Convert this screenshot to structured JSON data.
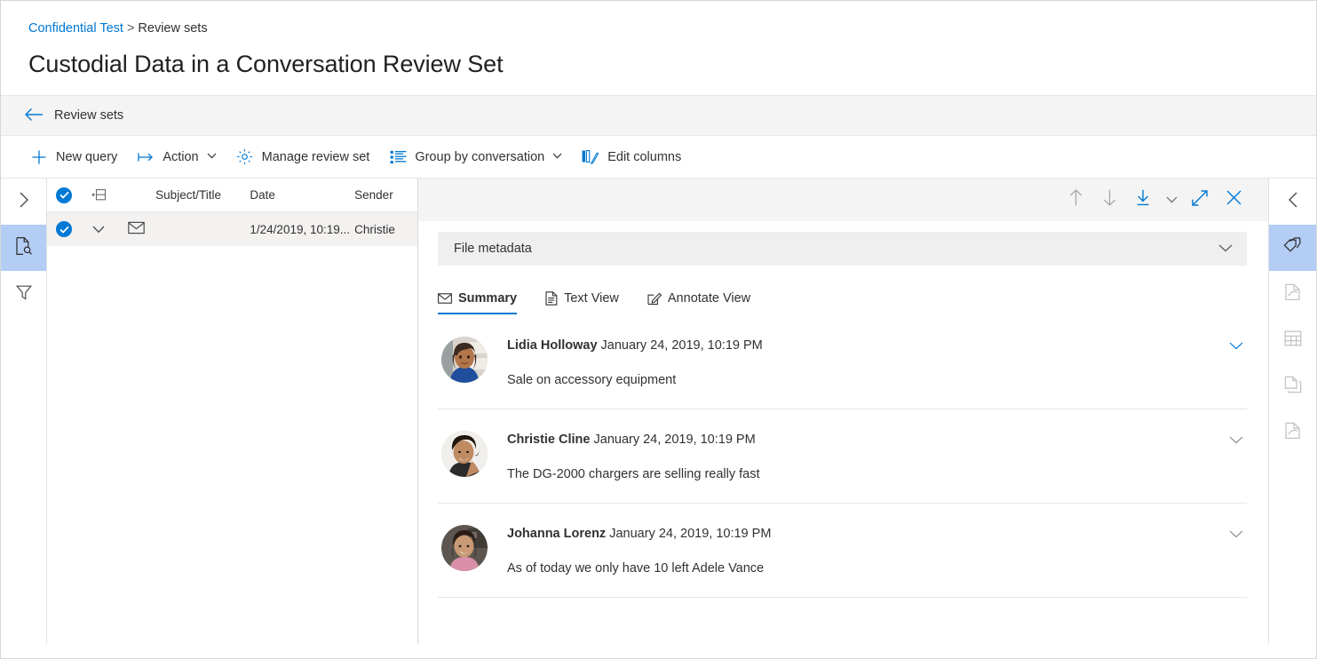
{
  "breadcrumb": {
    "link": "Confidential Test",
    "separator": ">",
    "current": "Review sets"
  },
  "page_title": "Custodial Data in a Conversation Review Set",
  "back_bar": {
    "label": "Review sets",
    "icon": "arrow-left-icon"
  },
  "command_bar": {
    "items": [
      {
        "label": "New query",
        "icon": "plus-icon",
        "chevron": false
      },
      {
        "label": "Action",
        "icon": "action-arrow-icon",
        "chevron": true
      },
      {
        "label": "Manage review set",
        "icon": "gear-icon",
        "chevron": false
      },
      {
        "label": "Group by conversation",
        "icon": "group-list-icon",
        "chevron": true
      },
      {
        "label": "Edit columns",
        "icon": "edit-columns-icon",
        "chevron": false
      }
    ]
  },
  "left_rail": {
    "items": [
      {
        "icon": "chevron-right-icon",
        "name": "expand-panel",
        "active": false,
        "dim": false
      },
      {
        "icon": "document-search-icon",
        "name": "search-documents",
        "active": true,
        "dim": false
      },
      {
        "icon": "filter-funnel-icon",
        "name": "filter",
        "active": false,
        "dim": false
      }
    ]
  },
  "list": {
    "columns": [
      "Subject/Title",
      "Date",
      "Sender"
    ],
    "header_icon": "columns-compact-icon",
    "rows": [
      {
        "selected": true,
        "expand_icon": "chevron-down-icon",
        "type_icon": "envelope-icon",
        "subject": "",
        "date": "1/24/2019, 10:19...",
        "sender": "Christie"
      }
    ]
  },
  "detail": {
    "toolbar": [
      {
        "icon": "arrow-up-icon",
        "name": "previous-item",
        "state": "disabled"
      },
      {
        "icon": "arrow-down-icon",
        "name": "next-item",
        "state": "disabled"
      },
      {
        "icon": "download-icon",
        "name": "download",
        "state": "enabled"
      },
      {
        "icon": "chevron-down-icon",
        "name": "download-options",
        "state": "enabled"
      },
      {
        "icon": "expand-diagonal-icon",
        "name": "expand",
        "state": "enabled"
      },
      {
        "icon": "close-icon",
        "name": "close",
        "state": "enabled"
      }
    ],
    "metadata_bar": {
      "label": "File metadata",
      "chevron": "chevron-down-icon"
    },
    "tabs": [
      {
        "label": "Summary",
        "icon": "envelope-icon",
        "active": true
      },
      {
        "label": "Text View",
        "icon": "document-text-icon",
        "active": false
      },
      {
        "label": "Annotate View",
        "icon": "annotate-pen-icon",
        "active": false
      }
    ],
    "messages": [
      {
        "sender": "Lidia Holloway",
        "date": "January 24, 2019, 10:19 PM",
        "text": "Sale on accessory equipment",
        "chevron": "chevron-down-icon",
        "chevron_color": "#0078d4",
        "avatar_tone": "#b2764a",
        "avatar_hair": "#3b2a20",
        "avatar_cloth": "#1f4e9c",
        "avatar_bg": "#d8d4cc"
      },
      {
        "sender": "Christie Cline",
        "date": "January 24, 2019, 10:19 PM",
        "text": "The DG-2000 chargers are selling really fast",
        "chevron": "chevron-down-icon",
        "chevron_color": "#8a8a8a",
        "avatar_tone": "#c08a63",
        "avatar_hair": "#20160f",
        "avatar_cloth": "#2b2b2b",
        "avatar_bg": "#f1efec"
      },
      {
        "sender": "Johanna Lorenz",
        "date": "January 24, 2019, 10:19 PM",
        "text": "As of today we only have 10 left Adele Vance",
        "chevron": "chevron-down-icon",
        "chevron_color": "#8a8a8a",
        "avatar_tone": "#c99a75",
        "avatar_hair": "#2a1c14",
        "avatar_cloth": "#d98fa8",
        "avatar_bg": "#5d5650"
      }
    ]
  },
  "right_rail": {
    "items": [
      {
        "icon": "chevron-left-icon",
        "name": "collapse-panel",
        "active": false,
        "dim": false
      },
      {
        "icon": "tag-icon",
        "name": "tags",
        "active": true,
        "dim": false
      },
      {
        "icon": "document-corner-icon",
        "name": "near-duplicates",
        "active": false,
        "dim": true
      },
      {
        "icon": "table-grid-icon",
        "name": "metadata-table",
        "active": false,
        "dim": true
      },
      {
        "icon": "stacked-pages-icon",
        "name": "duplicates",
        "active": false,
        "dim": true
      },
      {
        "icon": "document-corner-icon",
        "name": "email-threads",
        "active": false,
        "dim": true
      }
    ]
  },
  "colors": {
    "accent": "#0078d4",
    "rail_active": "#b3cdf5",
    "row_selected": "#f3f2f1",
    "meta_bar": "#efefef",
    "backbar": "#f4f4f4"
  }
}
